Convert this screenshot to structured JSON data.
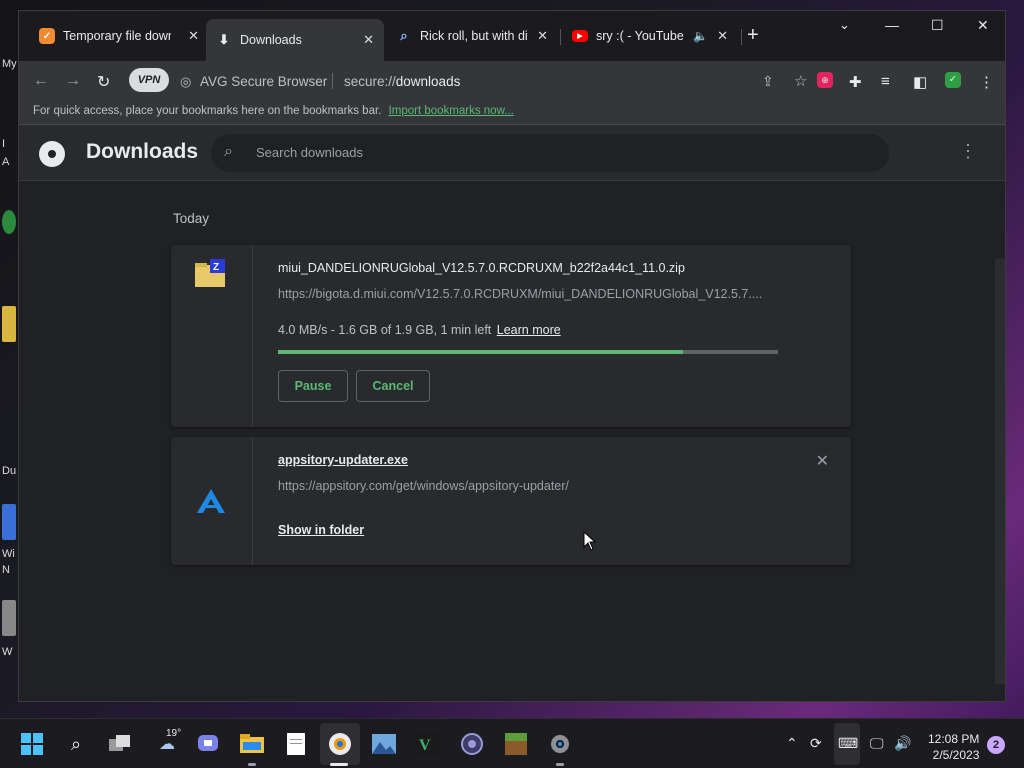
{
  "desktop": {
    "partial_labels": [
      "My",
      "I",
      "A",
      "Du",
      "Wi",
      "N",
      "W"
    ]
  },
  "tabs": [
    {
      "title": "Temporary file download",
      "favicon": "avg-icon",
      "color": "#f28b30",
      "active": false
    },
    {
      "title": "Downloads",
      "favicon": "download-icon",
      "active": true
    },
    {
      "title": "Rick roll, but with different",
      "favicon": "search-icon",
      "active": false
    },
    {
      "title": "sry :( - YouTube",
      "favicon": "youtube-icon",
      "color": "#ff0000",
      "active": false,
      "audio": true
    }
  ],
  "toolbar": {
    "vpn_label": "VPN",
    "browser_name": "AVG Secure Browser",
    "url_scheme": "secure://",
    "url_path": "downloads"
  },
  "bookmarks_bar": {
    "message": "For quick access, place your bookmarks here on the bookmarks bar.",
    "import_link": "Import bookmarks now..."
  },
  "downloads_page": {
    "title": "Downloads",
    "search_placeholder": "Search downloads",
    "date_group": "Today",
    "items": [
      {
        "filename": "miui_DANDELIONRUGlobal_V12.5.7.0.RCDRUXM_b22f2a44c1_11.0.zip",
        "url": "https://bigota.d.miui.com/V12.5.7.0.RCDRUXM/miui_DANDELIONRUGlobal_V12.5.7....",
        "status": "4.0 MB/s - 1.6 GB of 1.9 GB, 1 min left",
        "learn_more": "Learn more",
        "progress_fraction": 0.81,
        "pause_label": "Pause",
        "cancel_label": "Cancel",
        "icon": "zip-archive-icon"
      },
      {
        "filename": "appsitory-updater.exe",
        "url": "https://appsitory.com/get/windows/appsitory-updater/",
        "show_in_folder": "Show in folder",
        "icon": "appsitory-icon"
      }
    ]
  },
  "taskbar": {
    "weather_temp": "19°",
    "time": "12:08 PM",
    "date": "2/5/2023",
    "notification_count": "2"
  },
  "colors": {
    "accent_green": "#5bb974",
    "window_bg": "#202124",
    "toolbar_bg": "#35363a"
  }
}
